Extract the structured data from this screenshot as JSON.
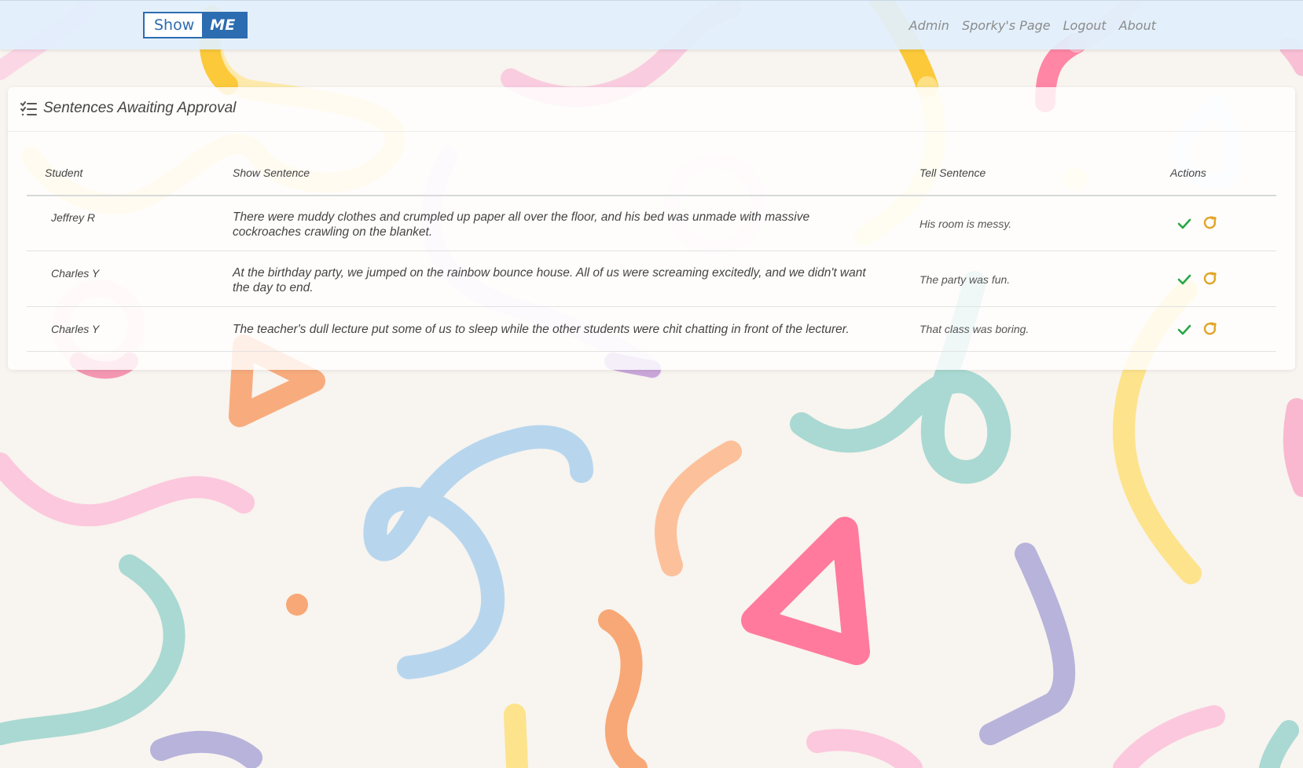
{
  "brand": {
    "show": "Show",
    "me": "ME"
  },
  "nav": {
    "items": [
      "Admin",
      "Sporky's Page",
      "Logout",
      "About"
    ]
  },
  "card": {
    "title": "Sentences Awaiting Approval",
    "icon": "list-check-icon"
  },
  "table": {
    "headers": [
      "Student",
      "Show Sentence",
      "Tell Sentence",
      "Actions"
    ],
    "rows": [
      {
        "student": "Jeffrey R",
        "show": "There were muddy clothes and crumpled up paper all over the floor, and his bed was unmade with massive cockroaches crawling on the blanket.",
        "tell": "His room is messy."
      },
      {
        "student": "Charles Y",
        "show": "At the birthday party, we jumped on the rainbow bounce house. All of us were screaming excitedly, and we didn't want the day to end.",
        "tell": "The party was fun."
      },
      {
        "student": "Charles Y",
        "show": "The teacher's dull lecture put some of us to sleep while the other students were chit chatting in front of the lecturer.",
        "tell": "That class was boring."
      }
    ],
    "actions": {
      "approve_icon": "check-icon",
      "redo_icon": "redo-icon"
    }
  },
  "colors": {
    "brand": "#2c6cb0",
    "approve": "#28a745",
    "redo": "#e0a526",
    "navbar": "#e1effc",
    "page_bg": "#f8f4ef"
  }
}
